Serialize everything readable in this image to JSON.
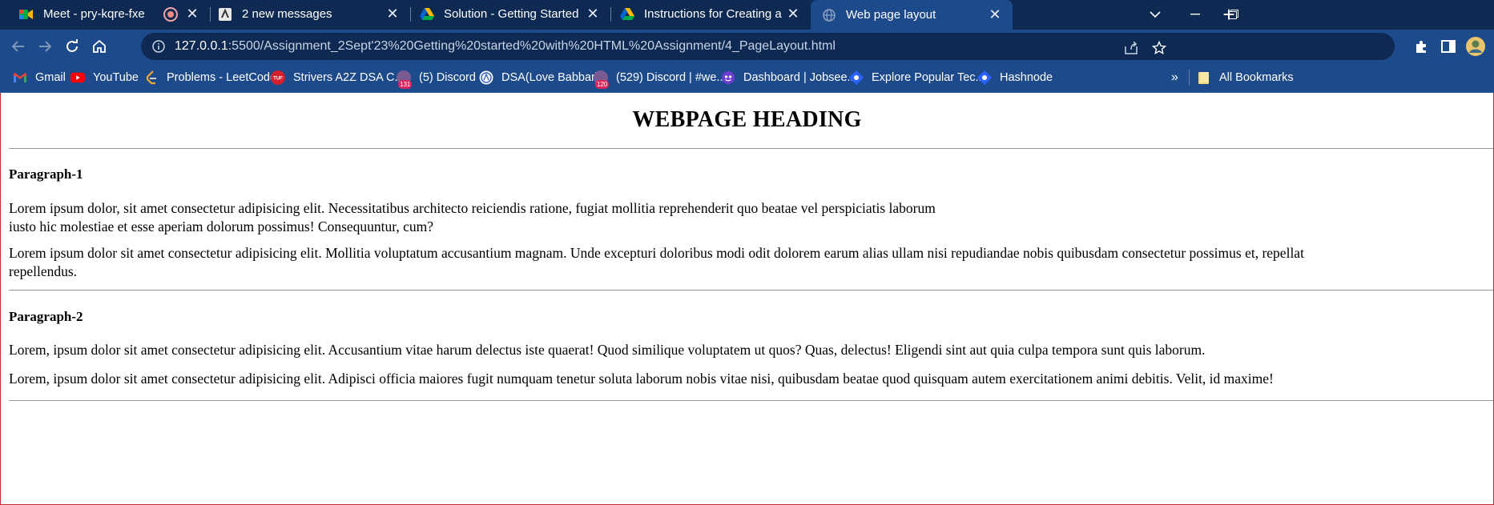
{
  "browser": {
    "tabs": [
      {
        "title": "Meet - pry-kqre-fxe",
        "favicon": "google-meet-icon",
        "recording": true
      },
      {
        "title": "2 new messages",
        "favicon": "app-icon"
      },
      {
        "title": "Solution - Getting Started With H",
        "favicon": "google-drive-icon"
      },
      {
        "title": "Instructions for Creating and Sub",
        "favicon": "google-drive-icon"
      },
      {
        "title": "Web page layout",
        "favicon": "globe-icon",
        "active": true
      }
    ],
    "url_host": "127.0.0.1",
    "url_rest": ":5500/Assignment_2Sept'23%20Getting%20started%20with%20HTML%20Assignment/4_PageLayout.html",
    "bookmarks": [
      {
        "label": "Gmail",
        "icon": "gmail-icon"
      },
      {
        "label": "YouTube",
        "icon": "youtube-icon"
      },
      {
        "label": "Problems - LeetCode",
        "icon": "leetcode-icon"
      },
      {
        "label": "Strivers A2Z DSA C...",
        "icon": "takeuforward-icon"
      },
      {
        "label": "(5) Discord",
        "icon": "discord-icon",
        "badge": "131"
      },
      {
        "label": "DSA(Love Babbar)",
        "icon": "love-babbar-icon"
      },
      {
        "label": "(529) Discord | #we...",
        "icon": "discord-icon",
        "badge": "120"
      },
      {
        "label": "Dashboard | Jobsee...",
        "icon": "jobsee-icon"
      },
      {
        "label": "Explore Popular Tec...",
        "icon": "hashnode-icon"
      },
      {
        "label": "Hashnode",
        "icon": "hashnode-icon"
      }
    ],
    "more_bookmarks": "»",
    "all_bookmarks": "All Bookmarks",
    "colors": {
      "tabstrip": "#0f2a52",
      "toolbar": "#1d4a8a",
      "omnibox": "#0f2a52"
    }
  },
  "page": {
    "heading": "WEBPAGE HEADING",
    "sections": [
      {
        "title": "Paragraph-1",
        "paragraphs": [
          {
            "lines": [
              "Lorem ipsum dolor, sit amet consectetur adipisicing elit. Necessitatibus architecto reiciendis ratione, fugiat mollitia reprehenderit quo beatae vel perspiciatis laborum",
              "iusto hic molestiae et esse aperiam dolorum possimus! Consequuntur, cum?"
            ]
          },
          {
            "lines": [
              "Lorem ipsum dolor sit amet consectetur adipisicing elit. Mollitia voluptatum accusantium magnam. Unde excepturi doloribus modi odit dolorem earum alias ullam nisi repudiandae nobis quibusdam consectetur possimus et, repellat",
              "repellendus."
            ]
          }
        ]
      },
      {
        "title": "Paragraph-2",
        "paragraphs": [
          {
            "lines": [
              "Lorem, ipsum dolor sit amet consectetur adipisicing elit. Accusantium vitae harum delectus iste quaerat! Quod similique voluptatem ut quos? Quas, delectus! Eligendi sint aut quia culpa tempora sunt quis laborum."
            ]
          },
          {
            "lines": [
              "Lorem, ipsum dolor sit amet consectetur adipisicing elit. Adipisci officia maiores fugit numquam tenetur soluta laborum nobis vitae nisi, quibusdam beatae quod quisquam autem exercitationem animi debitis. Velit, id maxime!"
            ]
          }
        ]
      }
    ]
  }
}
